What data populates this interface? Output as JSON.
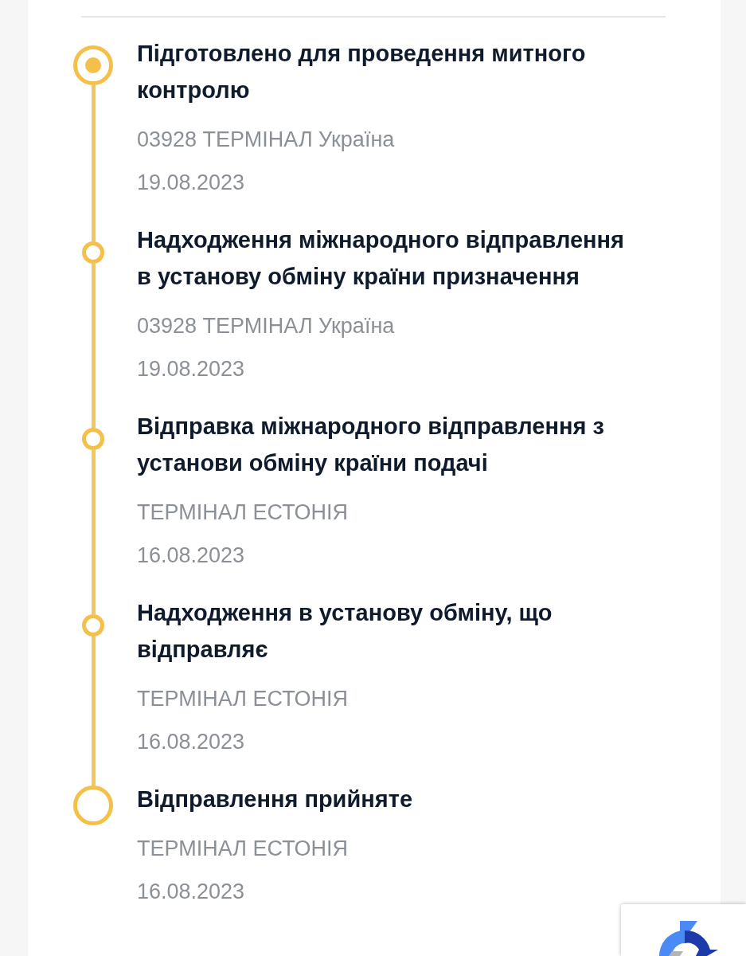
{
  "events": [
    {
      "kind": "current",
      "title": "Підготовлено для проведення митного контролю",
      "location": "03928 ТЕРМІНАЛ Україна",
      "date": "19.08.2023"
    },
    {
      "kind": "transit",
      "title": "Надходження міжнародного відправлення в установу обміну країни призначення",
      "location": "03928 ТЕРМІНАЛ Україна",
      "date": "19.08.2023"
    },
    {
      "kind": "transit",
      "title": "Відправка міжнародного відправлення з установи обміну країни подачі",
      "location": "ТЕРМІНАЛ ЕСТОНІЯ",
      "date": "16.08.2023"
    },
    {
      "kind": "transit",
      "title": "Надходження в установу обміну, що відправляє",
      "location": "ТЕРМІНАЛ ЕСТОНІЯ",
      "date": "16.08.2023"
    },
    {
      "kind": "origin",
      "title": "Відправлення прийняте",
      "location": "ТЕРМІНАЛ ЕСТОНІЯ",
      "date": "16.08.2023"
    }
  ]
}
